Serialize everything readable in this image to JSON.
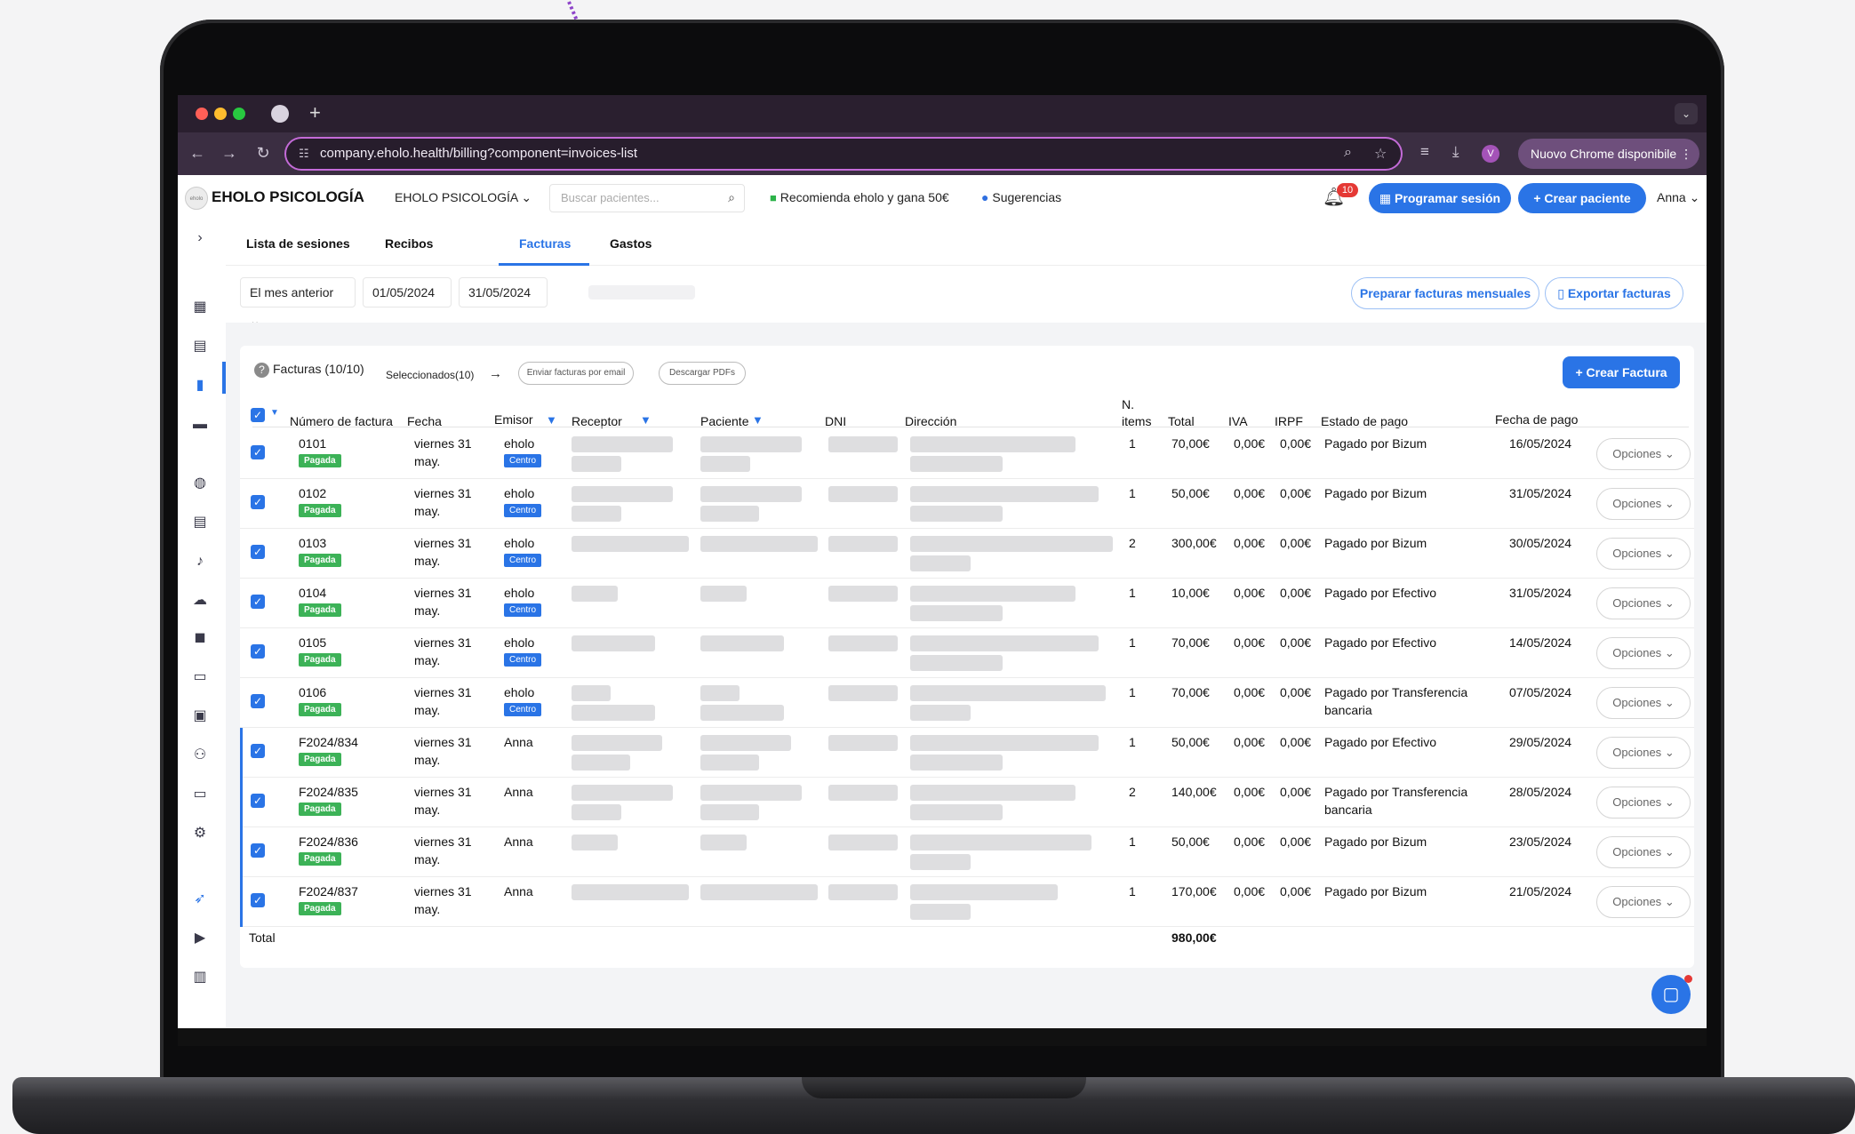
{
  "browser": {
    "url": "company.eholo.health/billing?component=invoices-list",
    "update_label": "Nuovo Chrome disponibile",
    "profile_initial": "V"
  },
  "header": {
    "logo_text": "eholo",
    "brand": "EHOLO PSICOLOGÍA",
    "org_select": "EHOLO PSICOLOGÍA",
    "search_placeholder": "Buscar pacientes...",
    "recommend": "Recomienda eholo y gana 50€",
    "suggestions": "Sugerencias",
    "notifications_count": "10",
    "schedule_button": "Programar sesión",
    "create_patient_button": "Crear paciente",
    "user": "Anna"
  },
  "tabs": [
    {
      "label": "Lista de sesiones"
    },
    {
      "label": "Recibos"
    },
    {
      "label": "Facturas",
      "active": true
    },
    {
      "label": "Gastos"
    }
  ],
  "filters": {
    "period": "El mes anterior",
    "date_from": "01/05/2024",
    "date_to": "31/05/2024",
    "prepare_button": "Preparar facturas mensuales",
    "export_button": "Exportar facturas"
  },
  "card": {
    "title": "Facturas (10/10)",
    "selected": "Seleccionados(10)",
    "email_button": "Enviar facturas por email",
    "pdf_button": "Descargar PDFs",
    "create_button": "Crear Factura"
  },
  "table": {
    "columns": {
      "number": "Número de factura",
      "date": "Fecha",
      "issuer": "Emisor",
      "receiver": "Receptor",
      "patient": "Paciente",
      "dni": "DNI",
      "address": "Dirección",
      "items_line1": "N.",
      "items_line2": "items",
      "total": "Total",
      "iva": "IVA",
      "irpf": "IRPF",
      "status": "Estado de pago",
      "pay_date": "Fecha de pago"
    },
    "paid_badge": "Pagada",
    "center_badge": "Centro",
    "options_label": "Opciones",
    "rows": [
      {
        "number": "0101",
        "date1": "viernes 31",
        "date2": "may.",
        "issuer": "eholo",
        "center": true,
        "items": "1",
        "total": "70,00€",
        "iva": "0,00€",
        "irpf": "0,00€",
        "status1": "Pagado por Bizum",
        "status2": "",
        "pay_date": "16/05/2024"
      },
      {
        "number": "0102",
        "date1": "viernes 31",
        "date2": "may.",
        "issuer": "eholo",
        "center": true,
        "items": "1",
        "total": "50,00€",
        "iva": "0,00€",
        "irpf": "0,00€",
        "status1": "Pagado por Bizum",
        "status2": "",
        "pay_date": "31/05/2024"
      },
      {
        "number": "0103",
        "date1": "viernes 31",
        "date2": "may.",
        "issuer": "eholo",
        "center": true,
        "items": "2",
        "total": "300,00€",
        "iva": "0,00€",
        "irpf": "0,00€",
        "status1": "Pagado por Bizum",
        "status2": "",
        "pay_date": "30/05/2024"
      },
      {
        "number": "0104",
        "date1": "viernes 31",
        "date2": "may.",
        "issuer": "eholo",
        "center": true,
        "items": "1",
        "total": "10,00€",
        "iva": "0,00€",
        "irpf": "0,00€",
        "status1": "Pagado por Efectivo",
        "status2": "",
        "pay_date": "31/05/2024"
      },
      {
        "number": "0105",
        "date1": "viernes 31",
        "date2": "may.",
        "issuer": "eholo",
        "center": true,
        "items": "1",
        "total": "70,00€",
        "iva": "0,00€",
        "irpf": "0,00€",
        "status1": "Pagado por Efectivo",
        "status2": "",
        "pay_date": "14/05/2024"
      },
      {
        "number": "0106",
        "date1": "viernes 31",
        "date2": "may.",
        "issuer": "eholo",
        "center": true,
        "items": "1",
        "total": "70,00€",
        "iva": "0,00€",
        "irpf": "0,00€",
        "status1": "Pagado por Transferencia",
        "status2": "bancaria",
        "pay_date": "07/05/2024"
      },
      {
        "number": "F2024/834",
        "date1": "viernes 31",
        "date2": "may.",
        "issuer": "Anna",
        "center": false,
        "items": "1",
        "total": "50,00€",
        "iva": "0,00€",
        "irpf": "0,00€",
        "status1": "Pagado por Efectivo",
        "status2": "",
        "pay_date": "29/05/2024"
      },
      {
        "number": "F2024/835",
        "date1": "viernes 31",
        "date2": "may.",
        "issuer": "Anna",
        "center": false,
        "items": "2",
        "total": "140,00€",
        "iva": "0,00€",
        "irpf": "0,00€",
        "status1": "Pagado por Transferencia",
        "status2": "bancaria",
        "pay_date": "28/05/2024"
      },
      {
        "number": "F2024/836",
        "date1": "viernes 31",
        "date2": "may.",
        "issuer": "Anna",
        "center": false,
        "items": "1",
        "total": "50,00€",
        "iva": "0,00€",
        "irpf": "0,00€",
        "status1": "Pagado por Bizum",
        "status2": "",
        "pay_date": "23/05/2024"
      },
      {
        "number": "F2024/837",
        "date1": "viernes 31",
        "date2": "may.",
        "issuer": "Anna",
        "center": false,
        "items": "1",
        "total": "170,00€",
        "iva": "0,00€",
        "irpf": "0,00€",
        "status1": "Pagado por Bizum",
        "status2": "",
        "pay_date": "21/05/2024"
      }
    ],
    "total_label": "Total",
    "total_value": "980,00€"
  },
  "colors": {
    "accent": "#2a74e6",
    "paid": "#3cb257",
    "badge": "#e53935",
    "browser": "#3b2e42"
  }
}
